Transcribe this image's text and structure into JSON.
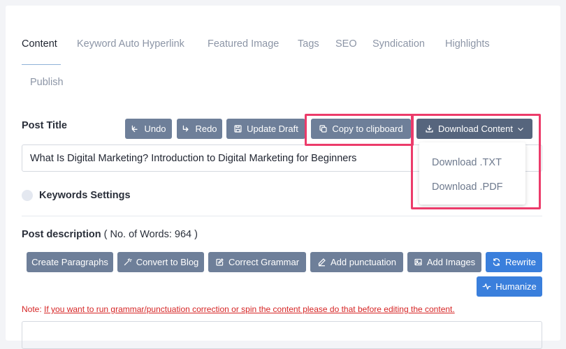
{
  "tabs": [
    {
      "label": "Content",
      "active": true
    },
    {
      "label": "Keyword Auto Hyperlink",
      "active": false
    },
    {
      "label": "Featured Image",
      "active": false
    },
    {
      "label": "Tags",
      "active": false
    },
    {
      "label": "SEO",
      "active": false
    },
    {
      "label": "Syndication",
      "active": false
    },
    {
      "label": "Highlights",
      "active": false
    },
    {
      "label": "Publish",
      "active": false
    }
  ],
  "post_title": {
    "label": "Post Title",
    "value": "What Is Digital Marketing? Introduction to Digital Marketing for Beginners"
  },
  "toolbar": {
    "undo": "Undo",
    "redo": "Redo",
    "update_draft": "Update Draft",
    "copy": "Copy to clipboard",
    "download": "Download Content"
  },
  "download_menu": {
    "txt": "Download .TXT",
    "pdf": "Download .PDF"
  },
  "keywords": {
    "label": "Keywords Settings"
  },
  "description": {
    "label": "Post description",
    "word_count_text": "( No. of Words: 964 )"
  },
  "actions": {
    "create_paragraphs": "Create Paragraphs",
    "convert_to_blog": "Convert to Blog",
    "correct_grammar": "Correct Grammar",
    "add_punctuation": "Add punctuation",
    "add_images": "Add Images",
    "rewrite": "Rewrite",
    "humanize": "Humanize"
  },
  "note": {
    "prefix": "Note: ",
    "text": "If you want to run grammar/punctuation correction or spin the content please do that before editing the content."
  },
  "colors": {
    "accent": "#3a7fdc",
    "button": "#6e7f99",
    "highlight": "#ec3b6a",
    "warning": "#d62525"
  }
}
